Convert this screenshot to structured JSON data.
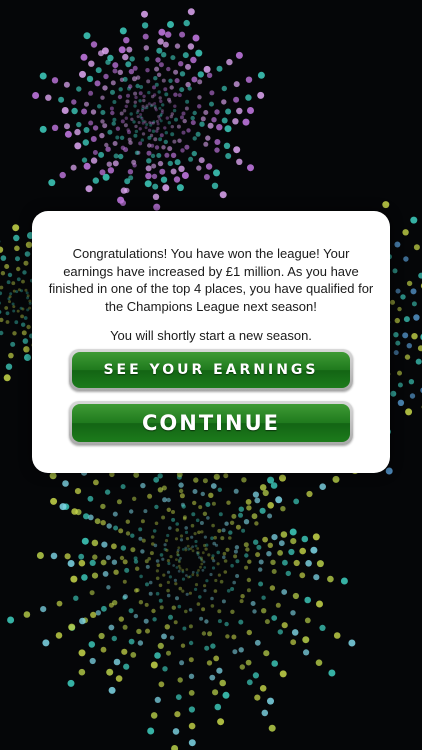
{
  "dialog": {
    "message": "Congratulations! You have won the league! Your earnings have increased by £1 million. As you have finished in one of the top 4 places, you have qualified for the Champions League next season!",
    "subtext": "You will shortly start a new season."
  },
  "buttons": {
    "earnings_label": "SEE YOUR EARNINGS",
    "continue_label": "CONTINUE"
  },
  "colors": {
    "background": "#050608",
    "button_green": "#1f7a1d",
    "firework_purple": "#c87be8",
    "firework_teal": "#3fd0c0",
    "firework_lime": "#c8d84a"
  }
}
